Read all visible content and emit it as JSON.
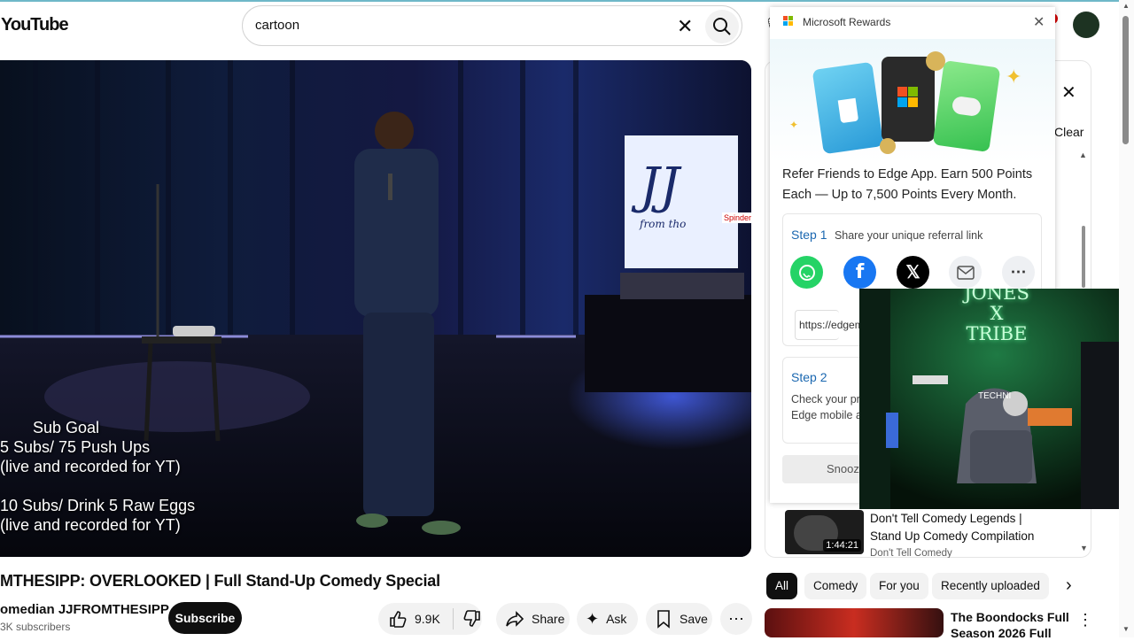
{
  "topbar": {
    "logo": "YouTube",
    "search_value": "cartoon",
    "avatar_badge_color": "#d00000"
  },
  "video": {
    "overlay_lines": [
      "Sub Goal",
      "5 Subs/ 75 Push Ups",
      "(live and recorded for YT)",
      "",
      "10 Subs/ Drink 5 Raw Eggs",
      "(live and recorded for YT)"
    ],
    "title": "MTHESIPP: OVERLOOKED | Full Stand-Up Comedy Special",
    "channel": "omedian JJFROMTHESIPP",
    "subscribers": "3K subscribers",
    "subscribe_label": "Subscribe",
    "like_count": "9.9K",
    "share_label": "Share",
    "ask_label": "Ask",
    "save_label": "Save",
    "stage_sign": "JJ",
    "stage_sign_sub": "from tho",
    "stage_sticker": "Spinder"
  },
  "rewards": {
    "title": "Microsoft Rewards",
    "promo": "Refer Friends to Edge App. Earn 500 Points Each — Up to 7,500 Points Every Month.",
    "step1_label": "Step 1",
    "step1_desc": "Share your unique referral link",
    "link_value": "https://edgem",
    "step2_label": "Step 2",
    "step2_desc_line1": "Check your pr",
    "step2_desc_line2": "Edge mobile a",
    "snooze_label": "Snooze"
  },
  "stream": {
    "sign": "JONES\nX\nTRIBE",
    "chair_label": "TECHNI"
  },
  "recommendations": {
    "clear_label": "Clear",
    "item": {
      "title": "Don't Tell Comedy Legends | Stand Up Comedy Compilation",
      "channel": "Don't Tell Comedy",
      "duration": "1:44:21"
    },
    "chips": [
      "All",
      "Comedy",
      "For you",
      "Recently uploaded"
    ],
    "next": {
      "title": "The Boondocks Full Season 2026 Full"
    }
  },
  "colors": {
    "accent_blue": "#1a67b0",
    "whatsapp": "#25d366",
    "facebook": "#1877f2",
    "x": "#000000"
  }
}
